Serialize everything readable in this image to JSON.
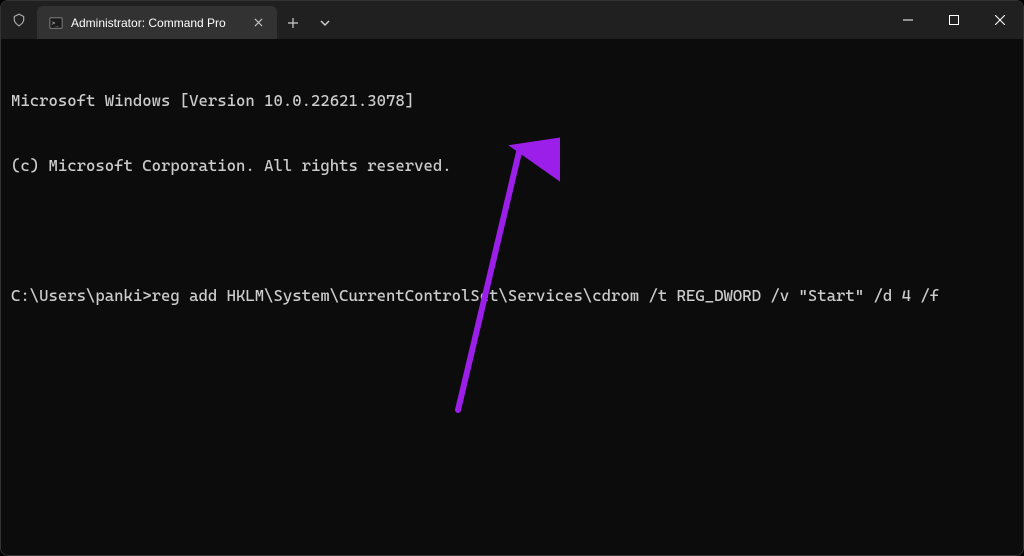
{
  "tab": {
    "title": "Administrator: Command Pro"
  },
  "terminal": {
    "banner_line1": "Microsoft Windows [Version 10.0.22621.3078]",
    "banner_line2": "(c) Microsoft Corporation. All rights reserved.",
    "prompt": "C:\\Users\\panki>",
    "command": "reg add HKLM\\System\\CurrentControlSet\\Services\\cdrom /t REG_DWORD /v \"Start\" /d 4 /f"
  },
  "annotation": {
    "arrow_color": "#9b1fe8"
  }
}
